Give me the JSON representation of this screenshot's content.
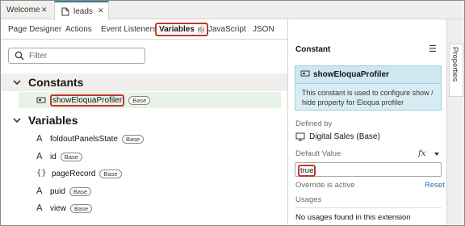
{
  "editor_tabs": [
    {
      "label": "Welcome"
    },
    {
      "label": "leads"
    }
  ],
  "nav_tabs": [
    "Page Designer",
    "Actions",
    "Event Listeners",
    "Variables",
    "JavaScript",
    "JSON"
  ],
  "variables_count": "(6)",
  "filter": {
    "placeholder": "Filter"
  },
  "constants": {
    "title": "Constants",
    "items": [
      {
        "name": "showEloquaProfiler",
        "badge": "Base"
      }
    ]
  },
  "variables": {
    "title": "Variables",
    "items": [
      {
        "name": "foldoutPanelsState",
        "badge": "Base",
        "icon": "A-type-icon"
      },
      {
        "name": "id",
        "badge": "Base",
        "icon": "A-type-icon"
      },
      {
        "name": "pageRecord",
        "badge": "Base",
        "icon": "object-braces-icon"
      },
      {
        "name": "puid",
        "badge": "Base",
        "icon": "A-type-icon"
      },
      {
        "name": "view",
        "badge": "Base",
        "icon": "A-type-icon"
      }
    ]
  },
  "panel": {
    "header": "Constant",
    "card_title": "showEloquaProfiler",
    "card_desc": "This constant is used to configure show / hide property for Eloqua profiler",
    "defined_by_label": "Defined by",
    "defined_by_value": "Digital Sales (Base)",
    "default_value_label": "Default Value",
    "fx_label": "fx",
    "default_value": "true",
    "override_text": "Override is active",
    "reset_label": "Reset",
    "usages_label": "Usages",
    "usages_text": "No usages found in this extension"
  },
  "rail": {
    "label": "Properties"
  },
  "colors": {
    "highlight": "#c0392b",
    "accent": "#3a7f8c",
    "selected_row": "#e7f3e6",
    "card": "#d8ecf3"
  }
}
